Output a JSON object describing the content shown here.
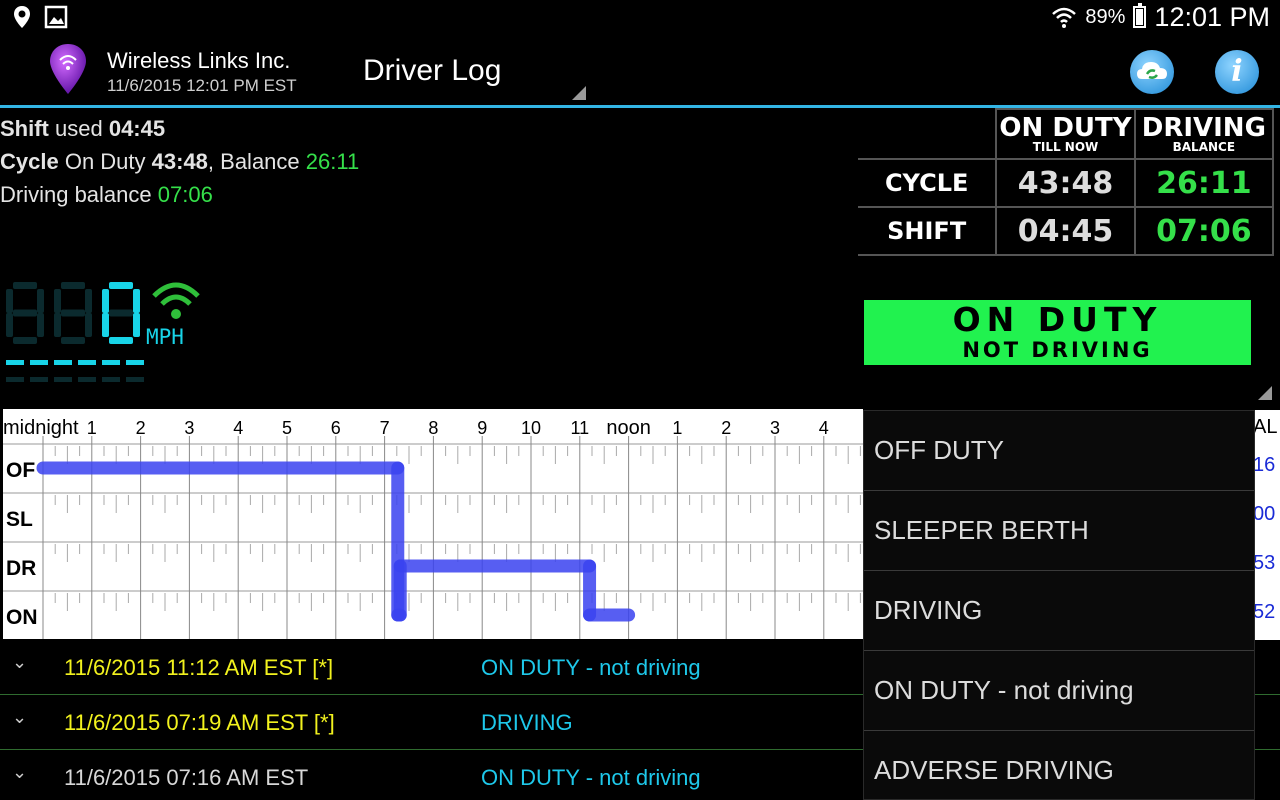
{
  "status_bar": {
    "icons": [
      "location-icon",
      "image-icon",
      "wifi-icon",
      "battery-icon"
    ],
    "battery_percent": "89%",
    "battery_level": 0.89,
    "time": "12:01 PM"
  },
  "app_bar": {
    "company": "Wireless Links Inc.",
    "datetime": "11/6/2015 12:01 PM EST",
    "title": "Driver Log",
    "actions": [
      "cloud-sync-icon",
      "info-icon"
    ],
    "accent": "#33b5e5"
  },
  "summary": {
    "shift_label": "Shift",
    "shift_used_text": " used ",
    "shift_used": "04:45",
    "cycle_label": "Cycle",
    "cycle_on_duty_text": " On Duty ",
    "cycle_on_duty": "43:48",
    "balance_text": ", Balance ",
    "cycle_balance": "26:11",
    "driving_balance_label": "Driving balance ",
    "driving_balance": "07:06"
  },
  "hours_table": {
    "col1_main": "ON DUTY",
    "col1_sub": "TILL NOW",
    "col2_main": "DRIVING",
    "col2_sub": "BALANCE",
    "rows": [
      {
        "label": "CYCLE",
        "on_duty": "43:48",
        "balance": "26:11"
      },
      {
        "label": "SHIFT",
        "on_duty": "04:45",
        "balance": "07:06"
      }
    ]
  },
  "status_banner": {
    "line1": "ON   DUTY",
    "line2": "NOT DRIVING",
    "color": "#21f24f"
  },
  "speedometer": {
    "speed": "0",
    "unit": "MPH",
    "digit_color": "#18d4e8",
    "dim_color": "#0b2a2e"
  },
  "log_graph": {
    "hour_labels": [
      "midnight",
      "1",
      "2",
      "3",
      "4",
      "5",
      "6",
      "7",
      "8",
      "9",
      "10",
      "11",
      "noon",
      "1",
      "2",
      "3",
      "4"
    ],
    "rows": [
      "OF",
      "SL",
      "DR",
      "ON"
    ],
    "line_color": "#3a43f0",
    "segments": [
      {
        "status": "OF",
        "start_hour": 0.0,
        "end_hour": 7.27
      },
      {
        "status": "ON",
        "start_hour": 7.27,
        "end_hour": 7.32
      },
      {
        "status": "DR",
        "start_hour": 7.32,
        "end_hour": 11.2
      },
      {
        "status": "ON",
        "start_hour": 11.2,
        "end_hour": 12.0
      }
    ],
    "right_values": [
      "AL",
      "16",
      "00",
      "53",
      "52"
    ]
  },
  "events": [
    {
      "time": "11/6/2015 11:12 AM EST [*]",
      "status": "ON DUTY - not driving",
      "time_color": "#f2f21e"
    },
    {
      "time": "11/6/2015 07:19 AM EST [*]",
      "status": "DRIVING",
      "time_color": "#f2f21e"
    },
    {
      "time": "11/6/2015 07:16 AM EST",
      "status": "ON DUTY - not driving",
      "time_color": "#d8d8d8"
    }
  ],
  "dropdown": {
    "options": [
      "OFF DUTY",
      "SLEEPER BERTH",
      "DRIVING",
      "ON DUTY - not driving",
      "ADVERSE DRIVING"
    ]
  }
}
